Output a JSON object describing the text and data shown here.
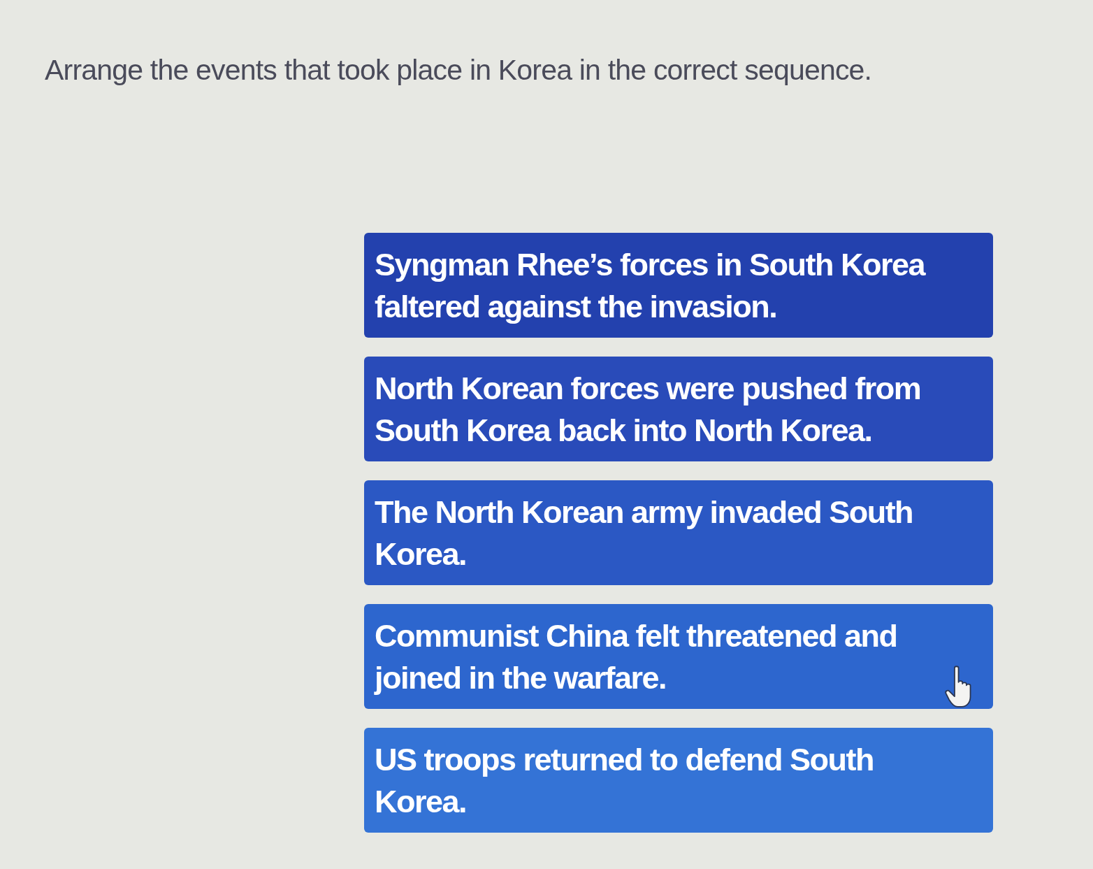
{
  "prompt": "Arrange the events that took place in Korea in the correct sequence.",
  "events": [
    {
      "text": "Syngman Rhee’s forces in South Korea faltered against the invasion.",
      "hovered": false
    },
    {
      "text": "North Korean forces were pushed from South Korea back into North Korea.",
      "hovered": false
    },
    {
      "text": "The North Korean army invaded South Korea.",
      "hovered": false
    },
    {
      "text": "Communist China felt threatened and joined in the warfare.",
      "hovered": true
    },
    {
      "text": "US troops returned to defend South Korea.",
      "hovered": false
    }
  ]
}
